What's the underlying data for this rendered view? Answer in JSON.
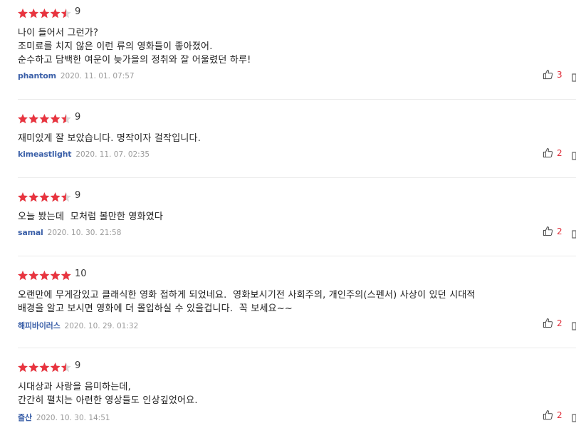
{
  "reviews": [
    {
      "rating": 4.5,
      "score": "9",
      "lines": [
        "나이 들어서 그런가?",
        "조미료를 치지 않은 이런 류의 영화들이 좋아졌어.",
        "순수하고 담백한 여운이 늦가을의 정취와 잘 어울렸던 하루!"
      ],
      "author": "phantom",
      "date": "2020. 11. 01. 07:57",
      "likes": "3"
    },
    {
      "rating": 4.5,
      "score": "9",
      "lines": [
        "재미있게 잘 보았습니다. 명작이자 걸작입니다."
      ],
      "author": "kimeastlight",
      "date": "2020. 11. 07. 02:35",
      "likes": "2"
    },
    {
      "rating": 4.5,
      "score": "9",
      "lines": [
        "오늘 봤는데  모처럼 볼만한 영화였다"
      ],
      "author": "samal",
      "date": "2020. 10. 30. 21:58",
      "likes": "2"
    },
    {
      "rating": 5,
      "score": "10",
      "lines": [
        "오랜만에 무게감있고 클래식한 영화 접하게 되었네요.  영화보시기전 사회주의, 개인주의(스펜서) 사상이 있던 시대적",
        "배경을 알고 보시면 영화에 더 몰입하실 수 있을겁니다.  꼭 보세요~~"
      ],
      "author": "해피바이러스",
      "date": "2020. 10. 29. 01:32",
      "likes": "2"
    },
    {
      "rating": 4.5,
      "score": "9",
      "lines": [
        "시대상과 사랑을 음미하는데,",
        "간간히 펼치는 아련한 영상들도 인상깊었어요."
      ],
      "author": "즐산",
      "date": "2020. 10. 30. 14:51",
      "likes": "2"
    }
  ],
  "colors": {
    "star": "#e8343f",
    "star_empty": "#d9d9d9",
    "author": "#3a5fa8",
    "likes": "#e0313d"
  },
  "icons": {
    "like": "thumbs-up-icon",
    "more": "more-icon"
  }
}
